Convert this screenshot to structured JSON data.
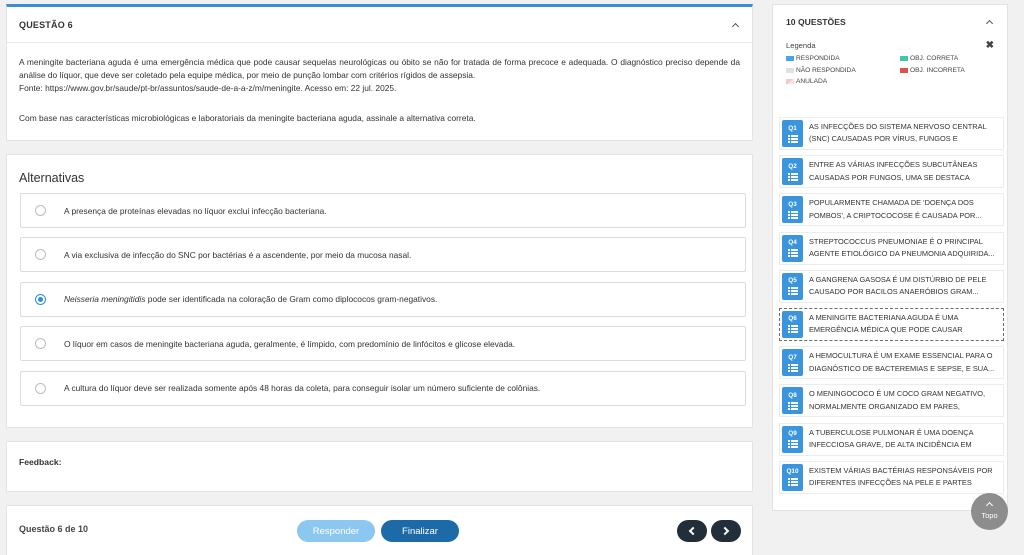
{
  "question": {
    "title": "QUESTÃO 6",
    "paragraph": "A meningite bacteriana aguda é uma emergência médica que pode causar sequelas neurológicas ou óbito se não for tratada de forma precoce e adequada. O diagnóstico preciso depende da análise do líquor, que deve ser coletado pela equipe médica, por meio de punção lombar com critérios rígidos de assepsia.",
    "source": "Fonte: https://www.gov.br/saude/pt-br/assuntos/saude-de-a-a-z/m/meningite. Acesso em: 22 jul. 2025.",
    "command": "Com base nas características microbiológicas e laboratoriais da meningite bacteriana aguda, assinale a alternativa correta."
  },
  "alternatives": {
    "title": "Alternativas",
    "items": [
      {
        "text": "A presença de proteínas elevadas no líquor exclui infecção bacteriana.",
        "selected": false
      },
      {
        "text": "A via exclusiva de infecção do SNC por bactérias é a ascendente, por meio da mucosa nasal.",
        "selected": false
      },
      {
        "em": "Neisseria meningitidis",
        "text": " pode ser identificada na coloração de Gram como diplococos gram-negativos.",
        "selected": true
      },
      {
        "text": "O líquor em casos de meningite bacteriana aguda, geralmente, é límpido, com predomínio de linfócitos e glicose elevada.",
        "selected": false
      },
      {
        "text": "A cultura do líquor deve ser realizada somente após 48 horas da coleta, para conseguir isolar um número suficiente de colônias.",
        "selected": false
      }
    ]
  },
  "feedback": {
    "label": "Feedback:"
  },
  "footer": {
    "counter": "Questão 6 de 10",
    "responder_label": "Responder",
    "finalizar_label": "Finalizar"
  },
  "sidebar": {
    "title": "10 QUESTÕES",
    "legend_label": "Legenda",
    "legend": {
      "respondida": "RESPONDIDA",
      "obj_correta": "OBJ. CORRETA",
      "nao_respondida": "NÃO RESPONDIDA",
      "obj_incorreta": "OBJ. INCORRETA",
      "anulada": "ANULADA"
    },
    "questions": [
      {
        "num": "Q1",
        "text": "AS INFECÇÕES DO SISTEMA NERVOSO CENTRAL (SNC) CAUSADAS POR VÍRUS, FUNGOS E BACTÉRIA..."
      },
      {
        "num": "Q2",
        "text": "ENTRE AS VÁRIAS INFECÇÕES SUBCUTÂNEAS CAUSADAS POR FUNGOS, UMA SE DESTACA PELA..."
      },
      {
        "num": "Q3",
        "text": "POPULARMENTE CHAMADA DE 'DOENÇA DOS POMBOS', A CRIPTOCOCOSE É CAUSADA POR..."
      },
      {
        "num": "Q4",
        "text": "STREPTOCOCCUS PNEUMONIAE É O PRINCIPAL AGENTE ETIOLÓGICO DA PNEUMONIA ADQUIRIDA..."
      },
      {
        "num": "Q5",
        "text": "A GANGRENA GASOSA É UM DISTÚRBIO DE PELE CAUSADO POR BACILOS ANAERÓBIOS GRAM..."
      },
      {
        "num": "Q6",
        "text": "A MENINGITE BACTERIANA AGUDA É UMA EMERGÊNCIA MÉDICA QUE PODE CAUSAR SEQUEL..."
      },
      {
        "num": "Q7",
        "text": "A HEMOCULTURA É UM EXAME ESSENCIAL PARA O DIAGNÓSTICO DE BACTEREMIAS E SEPSE, E SUA..."
      },
      {
        "num": "Q8",
        "text": "O MENINGOCOCO É UM COCO GRAM NEGATIVO, NORMALMENTE ORGANIZADO EM PARES, CATALAS..."
      },
      {
        "num": "Q9",
        "text": "A TUBERCULOSE PULMONAR É UMA DOENÇA INFECCIOSA GRAVE, DE ALTA INCIDÊNCIA EM PAÍSE..."
      },
      {
        "num": "Q10",
        "text": "EXISTEM VÁRIAS BACTÉRIAS RESPONSÁVEIS POR DIFERENTES INFECÇÕES NA PELE E PARTES MOLES,..."
      }
    ],
    "current_index": 5
  },
  "topo": {
    "label": "Topo"
  },
  "colors": {
    "accent": "#3a8fd6",
    "badge": "#3a95dd",
    "finalizar": "#1d6aa8",
    "responder": "#8cc7f0",
    "nav": "#222f3a"
  }
}
